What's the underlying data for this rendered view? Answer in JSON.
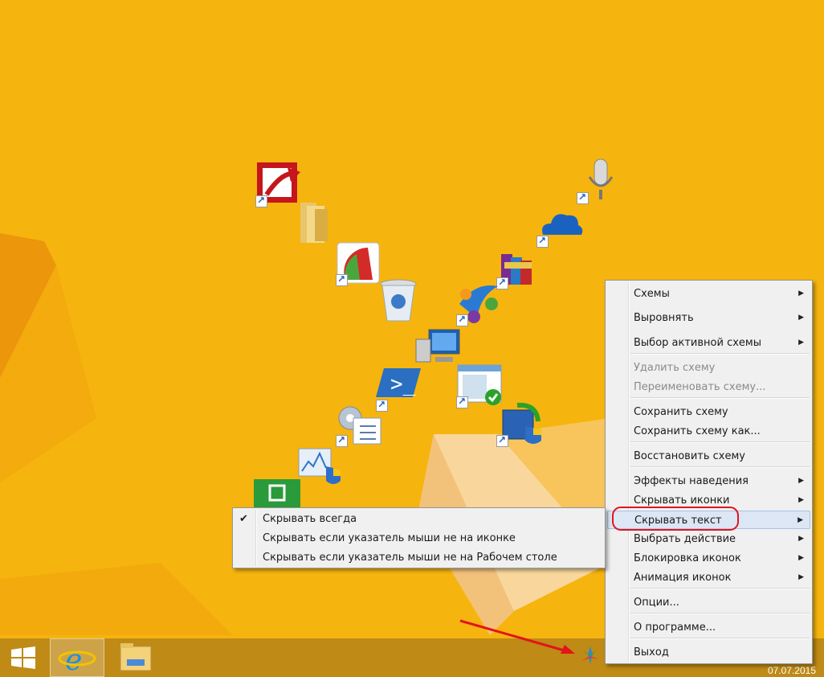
{
  "colors": {
    "desktop": "#f6b40e",
    "menu_bg": "#f0f0f0",
    "highlight": "#dce6f4",
    "annotation_red": "#e3141a"
  },
  "desktop_icons": [
    {
      "name": "red-app-icon",
      "shortcut": true
    },
    {
      "name": "folder-icon",
      "shortcut": false
    },
    {
      "name": "gauge-app-icon",
      "shortcut": true
    },
    {
      "name": "recycle-bin-icon",
      "shortcut": false
    },
    {
      "name": "computer-icon",
      "shortcut": false
    },
    {
      "name": "powershell-icon",
      "shortcut": true
    },
    {
      "name": "task-scheduler-icon",
      "shortcut": true
    },
    {
      "name": "resource-monitor-icon",
      "shortcut": false
    },
    {
      "name": "store-icon",
      "shortcut": false
    },
    {
      "name": "microphone-icon",
      "shortcut": true
    },
    {
      "name": "onedrive-icon",
      "shortcut": true
    },
    {
      "name": "winrar-icon",
      "shortcut": true
    },
    {
      "name": "people-app-icon",
      "shortcut": true
    },
    {
      "name": "window-check-icon",
      "shortcut": true
    },
    {
      "name": "system-restore-icon",
      "shortcut": true
    }
  ],
  "context_menu": {
    "items": [
      {
        "label": "Схемы",
        "submenu": true,
        "disabled": false
      },
      {
        "label": "Выровнять",
        "submenu": true,
        "disabled": false
      },
      {
        "label": "Выбор активной схемы",
        "submenu": true,
        "disabled": false
      },
      {
        "label": "Удалить схему",
        "submenu": false,
        "disabled": true
      },
      {
        "label": "Переименовать схему...",
        "submenu": false,
        "disabled": true
      },
      {
        "label": "Сохранить схему",
        "submenu": false,
        "disabled": false
      },
      {
        "label": "Сохранить схему как...",
        "submenu": false,
        "disabled": false
      },
      {
        "label": "Восстановить схему",
        "submenu": false,
        "disabled": false
      },
      {
        "label": "Эффекты наведения",
        "submenu": true,
        "disabled": false
      },
      {
        "label": "Скрывать иконки",
        "submenu": true,
        "disabled": false
      },
      {
        "label": "Скрывать текст",
        "submenu": true,
        "disabled": false,
        "highlighted": true
      },
      {
        "label": "Выбрать действие",
        "submenu": true,
        "disabled": false
      },
      {
        "label": "Блокировка иконок",
        "submenu": true,
        "disabled": false
      },
      {
        "label": "Анимация иконок",
        "submenu": true,
        "disabled": false
      },
      {
        "label": "Опции...",
        "submenu": false,
        "disabled": false
      },
      {
        "label": "О программе...",
        "submenu": false,
        "disabled": false
      },
      {
        "label": "Выход",
        "submenu": false,
        "disabled": false
      }
    ]
  },
  "submenu": {
    "items": [
      {
        "label": "Скрывать всегда",
        "checked": true
      },
      {
        "label": "Скрывать если указатель мыши не на иконке",
        "checked": false
      },
      {
        "label": "Скрывать если указатель мыши не на Рабочем столе",
        "checked": false
      }
    ]
  },
  "taskbar": {
    "date": "07.07.2015",
    "buttons": [
      "start-icon",
      "internet-explorer-icon",
      "file-explorer-icon"
    ],
    "tray_icons": [
      "fences-tray-icon"
    ]
  }
}
